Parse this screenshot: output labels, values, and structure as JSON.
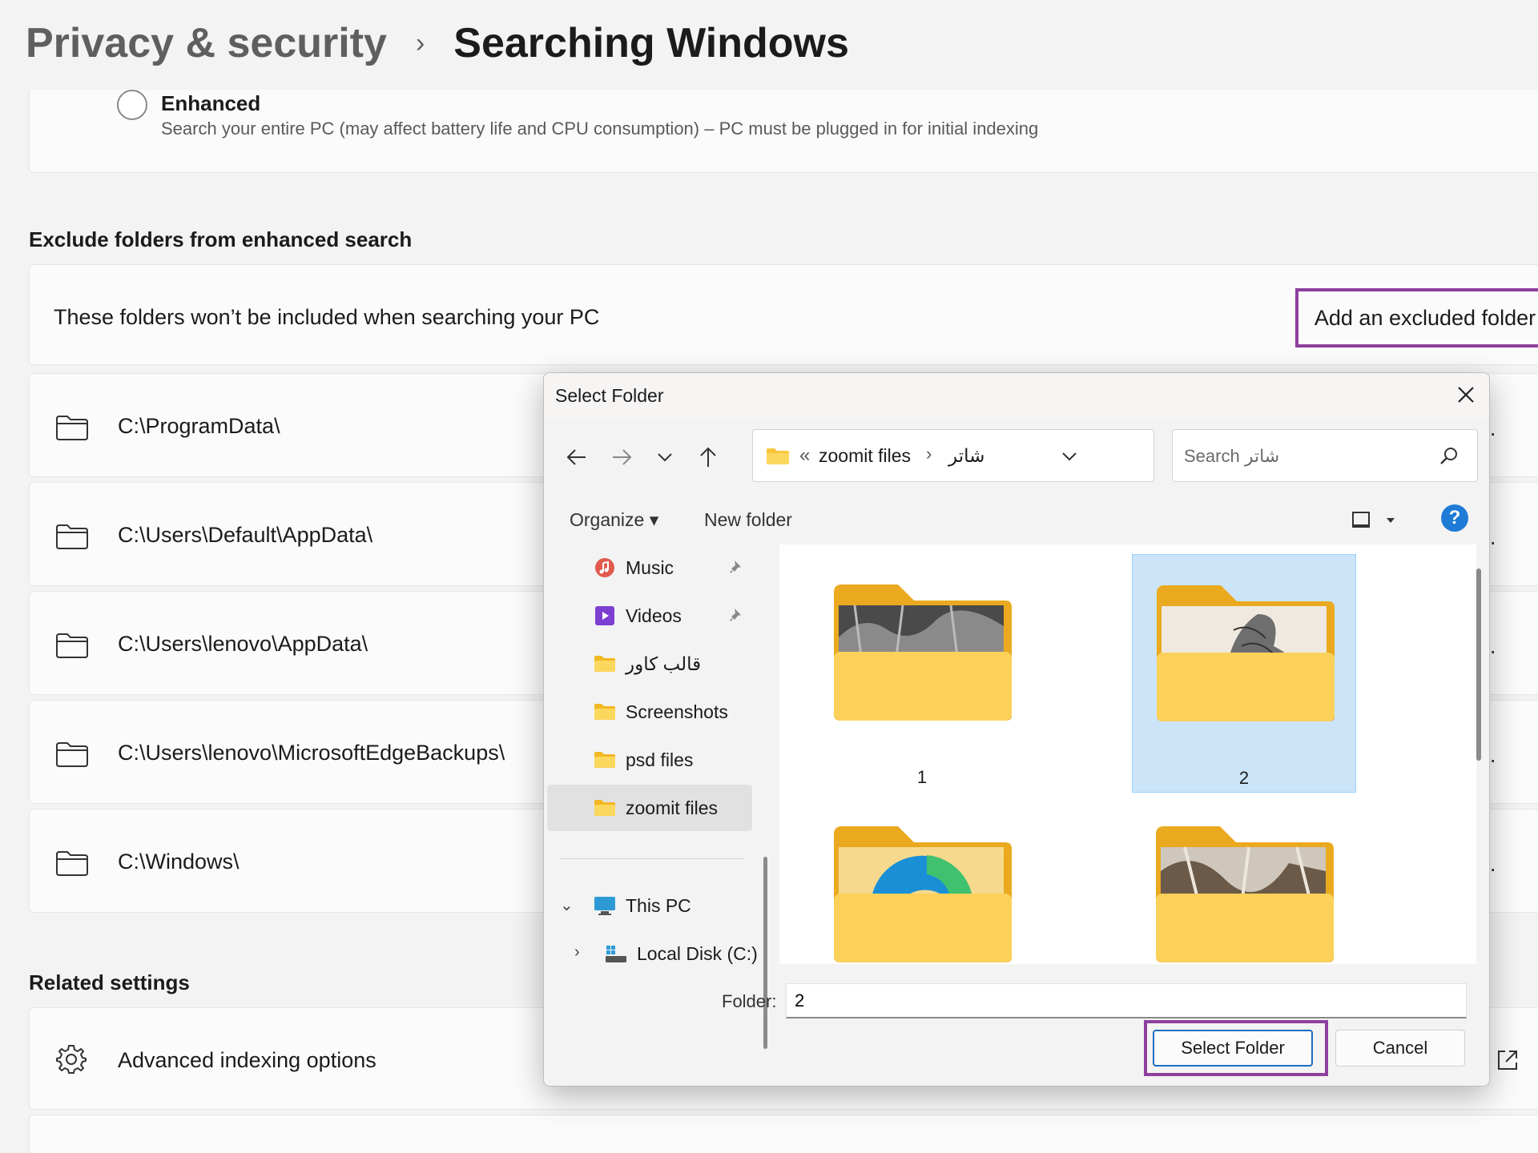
{
  "header": {
    "parent": "Privacy & security",
    "separator": "›",
    "current": "Searching Windows"
  },
  "enhanced": {
    "title": "Enhanced",
    "description": "Search your entire PC (may affect battery life and CPU consumption) – PC must be plugged in for initial indexing",
    "selected": false
  },
  "exclude": {
    "section_title": "Exclude folders from enhanced search",
    "description": "These folders won’t be included when searching your PC",
    "add_button": "Add an excluded folder",
    "folders": [
      "C:\\ProgramData\\",
      "C:\\Users\\Default\\AppData\\",
      "C:\\Users\\lenovo\\AppData\\",
      "C:\\Users\\lenovo\\MicrosoftEdgeBackups\\",
      "C:\\Windows\\"
    ]
  },
  "related": {
    "section_title": "Related settings",
    "advanced": "Advanced indexing options"
  },
  "dialog": {
    "title": "Select Folder",
    "address": {
      "overflow": "«",
      "segments": [
        "zoomit files",
        "شاتر"
      ],
      "separator": "›"
    },
    "search_placeholder": "Search شاتر",
    "toolbar": {
      "organize": "Organize ▾",
      "new_folder": "New folder",
      "help": "?"
    },
    "nav": [
      {
        "label": "Music",
        "icon": "music-icon",
        "pinned": true
      },
      {
        "label": "Videos",
        "icon": "videos-icon",
        "pinned": true
      },
      {
        "label": "قالب کاور",
        "icon": "folder-icon",
        "pinned": false
      },
      {
        "label": "Screenshots",
        "icon": "folder-icon",
        "pinned": false
      },
      {
        "label": "psd files",
        "icon": "folder-icon",
        "pinned": false
      },
      {
        "label": "zoomit files",
        "icon": "folder-icon",
        "pinned": false,
        "selected": true
      }
    ],
    "this_pc": "This PC",
    "local_disk": "Local Disk (C:)",
    "tiles": [
      {
        "label": "1",
        "selected": false
      },
      {
        "label": "2",
        "selected": true
      },
      {
        "label": "",
        "selected": false
      },
      {
        "label": "",
        "selected": false
      }
    ],
    "folder_label": "Folder:",
    "folder_value": "2",
    "select_button": "Select Folder",
    "cancel_button": "Cancel"
  },
  "colors": {
    "highlight": "#8e3f9e",
    "folder_yellow": "#f8c63a",
    "selection": "#cce4f7",
    "accent": "#1e7bd6"
  }
}
